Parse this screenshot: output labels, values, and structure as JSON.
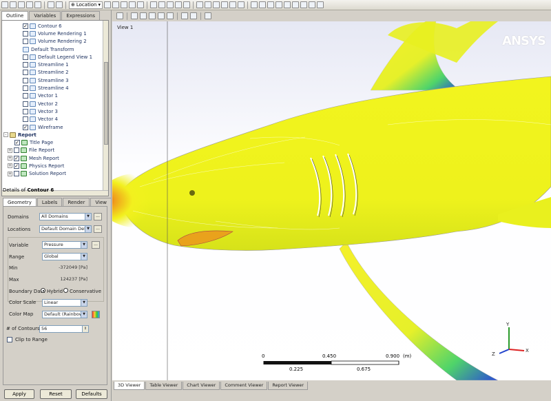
{
  "toolbar": {
    "location_label": "Location"
  },
  "tree_tabs": [
    "Outline",
    "Variables",
    "Expressions"
  ],
  "tree": [
    {
      "label": "Contour 6",
      "checked": true,
      "indent": 30,
      "icon": "contour-icon"
    },
    {
      "label": "Volume Rendering 1",
      "checked": false,
      "indent": 30,
      "icon": "volume-icon"
    },
    {
      "label": "Volume Rendering 2",
      "checked": false,
      "indent": 30,
      "icon": "volume-icon"
    },
    {
      "label": "Default Transform",
      "checked": null,
      "indent": 30,
      "icon": "transform-icon"
    },
    {
      "label": "Default Legend View 1",
      "checked": false,
      "indent": 30,
      "icon": "legend-icon"
    },
    {
      "label": "Streamline 1",
      "checked": false,
      "indent": 30,
      "icon": "streamline-icon"
    },
    {
      "label": "Streamline 2",
      "checked": false,
      "indent": 30,
      "icon": "streamline-icon"
    },
    {
      "label": "Streamline 3",
      "checked": false,
      "indent": 30,
      "icon": "streamline-icon"
    },
    {
      "label": "Streamline 4",
      "checked": false,
      "indent": 30,
      "icon": "streamline-icon"
    },
    {
      "label": "Vector 1",
      "checked": false,
      "indent": 30,
      "icon": "vector-icon"
    },
    {
      "label": "Vector 2",
      "checked": false,
      "indent": 30,
      "icon": "vector-icon"
    },
    {
      "label": "Vector 3",
      "checked": false,
      "indent": 30,
      "icon": "vector-icon"
    },
    {
      "label": "Vector 4",
      "checked": false,
      "indent": 30,
      "icon": "vector-icon"
    },
    {
      "label": "Wireframe",
      "checked": true,
      "indent": 30,
      "icon": "wireframe-icon"
    },
    {
      "label": "Report",
      "checked": null,
      "indent": 2,
      "icon": "report-icon",
      "bold": true,
      "expander": "-"
    },
    {
      "label": "Title Page",
      "checked": true,
      "indent": 18,
      "icon": "page-icon"
    },
    {
      "label": "File Report",
      "checked": false,
      "indent": 18,
      "icon": "page-icon",
      "expander": "+"
    },
    {
      "label": "Mesh Report",
      "checked": true,
      "indent": 18,
      "icon": "page-icon",
      "expander": "+"
    },
    {
      "label": "Physics Report",
      "checked": true,
      "indent": 18,
      "icon": "page-icon",
      "expander": "+"
    },
    {
      "label": "Solution Report",
      "checked": false,
      "indent": 18,
      "icon": "page-icon",
      "expander": "+"
    }
  ],
  "details": {
    "prefix": "Details of ",
    "name": "Contour 6",
    "tabs": [
      "Geometry",
      "Labels",
      "Render",
      "View"
    ],
    "domains_label": "Domains",
    "domains_value": "All Domains",
    "locations_label": "Locations",
    "locations_value": "Default Domain Defa",
    "variable_label": "Variable",
    "variable_value": "Pressure",
    "range_label": "Range",
    "range_value": "Global",
    "min_label": "Min",
    "min_value": "-372049 [Pa]",
    "max_label": "Max",
    "max_value": "124237 [Pa]",
    "boundary_label": "Boundary Data",
    "hybrid_label": "Hybrid",
    "conservative_label": "Conservative",
    "colorscale_label": "Color Scale",
    "colorscale_value": "Linear",
    "colormap_label": "Color Map",
    "colormap_value": "Default (Rainbow",
    "contours_label": "# of Contours",
    "contours_value": "56",
    "clip_label": "Clip to Range",
    "ellipsis": "..."
  },
  "buttons": {
    "apply": "Apply",
    "reset": "Reset",
    "defaults": "Defaults"
  },
  "view": {
    "label": "View 1",
    "logo": "ANSYS",
    "scale": {
      "top": [
        "0",
        "0.450",
        "0.900"
      ],
      "bottom": [
        "0.225",
        "0.675"
      ],
      "unit": "(m)"
    }
  },
  "viewer_tabs": [
    "3D Viewer",
    "Table Viewer",
    "Chart Viewer",
    "Comment Viewer",
    "Report Viewer"
  ]
}
